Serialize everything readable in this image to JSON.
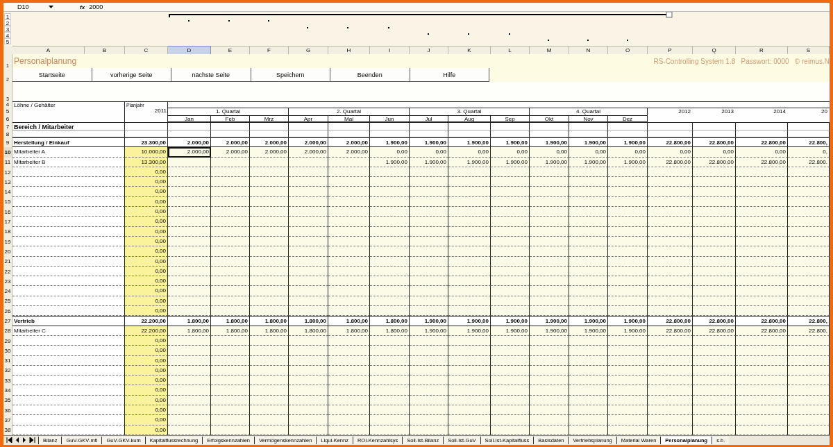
{
  "formula_bar": {
    "cell_ref": "D10",
    "function_label": "fx",
    "value": "2000"
  },
  "outline_levels": [
    "1",
    "2",
    "3",
    "4",
    "5"
  ],
  "columns": [
    {
      "label": "A",
      "selected": false
    },
    {
      "label": "B",
      "selected": false
    },
    {
      "label": "C",
      "selected": false
    },
    {
      "label": "D",
      "selected": true
    },
    {
      "label": "E",
      "selected": false
    },
    {
      "label": "F",
      "selected": false
    },
    {
      "label": "G",
      "selected": false
    },
    {
      "label": "H",
      "selected": false
    },
    {
      "label": "I",
      "selected": false
    },
    {
      "label": "J",
      "selected": false
    },
    {
      "label": "K",
      "selected": false
    },
    {
      "label": "L",
      "selected": false
    },
    {
      "label": "M",
      "selected": false
    },
    {
      "label": "N",
      "selected": false
    },
    {
      "label": "O",
      "selected": false
    },
    {
      "label": "P",
      "selected": false
    },
    {
      "label": "Q",
      "selected": false
    },
    {
      "label": "R",
      "selected": false
    },
    {
      "label": "S",
      "selected": false
    }
  ],
  "title_row": {
    "number": "1",
    "title": "Personalplanung",
    "info": "RS-Controlling System 1.8   Passwort: 0000   © reimus.N"
  },
  "button_row": {
    "number": "2",
    "buttons": [
      "Startseite",
      "vorherige Seite",
      "nächste Seite",
      "Speichern",
      "Beenden",
      "Hilfe"
    ]
  },
  "spacer_row": {
    "number": "3"
  },
  "header": {
    "row_numbers": [
      "4",
      "5",
      "6",
      "7",
      "8"
    ],
    "group_label": "Löhne / Gehälter",
    "plan_label": "Planjahr",
    "plan_year": "2011",
    "quarters": [
      {
        "label": "1. Quartal",
        "months": [
          "Jan",
          "Feb",
          "Mrz"
        ]
      },
      {
        "label": "2. Quartal",
        "months": [
          "Apr",
          "Mai",
          "Jun"
        ]
      },
      {
        "label": "3. Quartal",
        "months": [
          "Jul",
          "Aug",
          "Sep"
        ]
      },
      {
        "label": "4. Quartal",
        "months": [
          "Okt",
          "Nov",
          "Dez"
        ]
      }
    ],
    "years": [
      "2012",
      "2013",
      "2014",
      "20"
    ],
    "area_label": "Bereich / Mitarbeiter"
  },
  "rows": [
    {
      "number": "9",
      "kind": "section",
      "selected": false,
      "label": "Herstellung / Einkauf",
      "cells": [
        "23.300,00",
        "2.000,00",
        "2.000,00",
        "2.000,00",
        "2.000,00",
        "2.000,00",
        "1.900,00",
        "1.900,00",
        "1.900,00",
        "1.900,00",
        "1.900,00",
        "1.900,00",
        "1.900,00",
        "22.800,00",
        "22.800,00",
        "22.800,00",
        "22.800,"
      ]
    },
    {
      "number": "10",
      "kind": "employee",
      "selected": true,
      "label": "Mitarbeiter A",
      "cells": [
        "10.000,00",
        "2.000,00",
        "2.000,00",
        "2.000,00",
        "2.000,00",
        "2.000,00",
        "0,00",
        "0,00",
        "0,00",
        "0,00",
        "0,00",
        "0,00",
        "0,00",
        "0,00",
        "0,00",
        "0,00",
        "0,"
      ]
    },
    {
      "number": "11",
      "kind": "employee",
      "selected": false,
      "label": "Mitarbeiter B",
      "cells": [
        "13.300,00",
        null,
        null,
        null,
        null,
        null,
        "1.900,00",
        "1.900,00",
        "1.900,00",
        "1.900,00",
        "1.900,00",
        "1.900,00",
        "1.900,00",
        "22.800,00",
        "22.800,00",
        "22.800,00",
        "22.800."
      ]
    },
    {
      "number": "12",
      "kind": "employee",
      "selected": false,
      "cells": [
        "0,00"
      ]
    },
    {
      "number": "13",
      "kind": "employee",
      "selected": false,
      "cells": [
        "0,00"
      ]
    },
    {
      "number": "14",
      "kind": "employee",
      "selected": false,
      "cells": [
        "0,00"
      ]
    },
    {
      "number": "15",
      "kind": "employee",
      "selected": false,
      "cells": [
        "0,00"
      ]
    },
    {
      "number": "16",
      "kind": "employee",
      "selected": false,
      "cells": [
        "0,00"
      ]
    },
    {
      "number": "17",
      "kind": "employee",
      "selected": false,
      "cells": [
        "0,00"
      ]
    },
    {
      "number": "18",
      "kind": "employee",
      "selected": false,
      "cells": [
        "0,00"
      ]
    },
    {
      "number": "19",
      "kind": "employee",
      "selected": false,
      "cells": [
        "0,00"
      ]
    },
    {
      "number": "20",
      "kind": "employee",
      "selected": false,
      "cells": [
        "0,00"
      ]
    },
    {
      "number": "21",
      "kind": "employee",
      "selected": false,
      "cells": [
        "0,00"
      ]
    },
    {
      "number": "22",
      "kind": "employee",
      "selected": false,
      "cells": [
        "0,00"
      ]
    },
    {
      "number": "23",
      "kind": "employee",
      "selected": false,
      "cells": [
        "0,00"
      ]
    },
    {
      "number": "24",
      "kind": "employee",
      "selected": false,
      "cells": [
        "0,00"
      ]
    },
    {
      "number": "25",
      "kind": "employee",
      "selected": false,
      "cells": [
        "0,00"
      ]
    },
    {
      "number": "26",
      "kind": "employee",
      "selected": false,
      "cells": [
        "0,00"
      ]
    },
    {
      "number": "27",
      "kind": "section",
      "selected": false,
      "label": "Vertrieb",
      "cells": [
        "22.200,00",
        "1.800,00",
        "1.800,00",
        "1.800,00",
        "1.800,00",
        "1.800,00",
        "1.800,00",
        "1.900,00",
        "1.900,00",
        "1.900,00",
        "1.900,00",
        "1.900,00",
        "1.900,00",
        "22.800,00",
        "22.800,00",
        "22.800,00",
        "22.800,"
      ]
    },
    {
      "number": "28",
      "kind": "employee",
      "selected": false,
      "label": "Mitarbeiter C",
      "cells": [
        "22.200,00",
        "1.800,00",
        "1.800,00",
        "1.800,00",
        "1.800,00",
        "1.800,00",
        "1.800,00",
        "1.900,00",
        "1.900,00",
        "1.900,00",
        "1.900,00",
        "1.900,00",
        "1.900,00",
        "22.800,00",
        "22.800,00",
        "22.800,00",
        "22.800,"
      ]
    },
    {
      "number": "29",
      "kind": "employee",
      "selected": false,
      "cells": [
        "0,00"
      ]
    },
    {
      "number": "30",
      "kind": "employee",
      "selected": false,
      "cells": [
        "0,00"
      ]
    },
    {
      "number": "31",
      "kind": "employee",
      "selected": false,
      "cells": [
        "0,00"
      ]
    },
    {
      "number": "32",
      "kind": "employee",
      "selected": false,
      "cells": [
        "0,00"
      ]
    },
    {
      "number": "33",
      "kind": "employee",
      "selected": false,
      "cells": [
        "0,00"
      ]
    },
    {
      "number": "34",
      "kind": "employee",
      "selected": false,
      "cells": [
        "0,00"
      ]
    },
    {
      "number": "35",
      "kind": "employee",
      "selected": false,
      "cells": [
        "0,00"
      ]
    },
    {
      "number": "36",
      "kind": "employee",
      "selected": false,
      "cells": [
        "0,00"
      ]
    },
    {
      "number": "37",
      "kind": "employee",
      "selected": false,
      "cells": [
        "0,00"
      ]
    },
    {
      "number": "38",
      "kind": "employee",
      "selected": false,
      "cells": [
        "0,00"
      ]
    }
  ],
  "sheet_tabs": [
    {
      "label": "Bilanz",
      "selected": false
    },
    {
      "label": "GuV-GKV-mtl",
      "selected": false
    },
    {
      "label": "GuV-GKV-kum",
      "selected": false
    },
    {
      "label": "Kapitalflussrechnung",
      "selected": false
    },
    {
      "label": "Erfolgskennzahlen",
      "selected": false
    },
    {
      "label": "Vermögenskennzahlen",
      "selected": false
    },
    {
      "label": "Liqui-Kennz",
      "selected": false
    },
    {
      "label": "ROI-Kennzahlsys",
      "selected": false
    },
    {
      "label": "Soll-Ist-Bilanz",
      "selected": false
    },
    {
      "label": "Soll-Ist-GuV",
      "selected": false
    },
    {
      "label": "Soll-Ist-Kapitalfluss",
      "selected": false
    },
    {
      "label": "Basisdaten",
      "selected": false
    },
    {
      "label": "Vertriebsplanung",
      "selected": false
    },
    {
      "label": "Material Waren",
      "selected": false
    },
    {
      "label": "Personalplanung",
      "selected": true
    },
    {
      "label": "s.b.",
      "selected": false
    }
  ]
}
